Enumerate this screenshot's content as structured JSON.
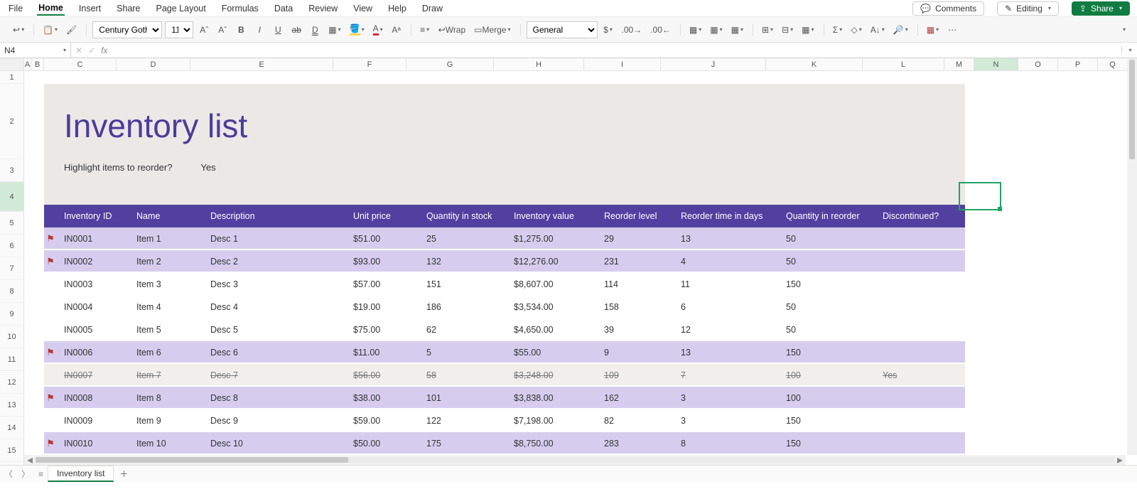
{
  "menu": {
    "tabs": [
      "File",
      "Home",
      "Insert",
      "Share",
      "Page Layout",
      "Formulas",
      "Data",
      "Review",
      "View",
      "Help",
      "Draw"
    ],
    "active": "Home",
    "right": {
      "comments": "Comments",
      "editing": "Editing",
      "share": "Share"
    }
  },
  "ribbon": {
    "font_family": "Century Gothi...",
    "font_size": "11",
    "wrap": "Wrap",
    "merge": "Merge",
    "number_format": "General"
  },
  "formula_bar": {
    "name_box": "N4",
    "formula": ""
  },
  "columns": [
    "A",
    "B",
    "C",
    "D",
    "E",
    "F",
    "G",
    "H",
    "I",
    "J",
    "K",
    "L",
    "M",
    "N",
    "O",
    "P",
    "Q"
  ],
  "selected_column": "N",
  "row_headers": [
    1,
    2,
    3,
    4,
    5,
    6,
    7,
    8,
    9,
    10,
    11,
    12,
    13,
    14,
    15
  ],
  "selected_row": 4,
  "inventory": {
    "title": "Inventory list",
    "subtitle_label": "Highlight items to reorder?",
    "subtitle_value": "Yes",
    "headers": {
      "flag": "",
      "id": "Inventory ID",
      "name": "Name",
      "desc": "Description",
      "price": "Unit price",
      "qty": "Quantity in stock",
      "val": "Inventory value",
      "rl": "Reorder level",
      "rt": "Reorder time in days",
      "qr": "Quantity in reorder",
      "disc": "Discontinued?"
    },
    "rows": [
      {
        "flag": true,
        "id": "IN0001",
        "name": "Item 1",
        "desc": "Desc 1",
        "price": "$51.00",
        "qty": "25",
        "val": "$1,275.00",
        "rl": "29",
        "rt": "13",
        "qr": "50",
        "disc": "",
        "style": "hl"
      },
      {
        "flag": true,
        "id": "IN0002",
        "name": "Item 2",
        "desc": "Desc 2",
        "price": "$93.00",
        "qty": "132",
        "val": "$12,276.00",
        "rl": "231",
        "rt": "4",
        "qr": "50",
        "disc": "",
        "style": "hl"
      },
      {
        "flag": false,
        "id": "IN0003",
        "name": "Item 3",
        "desc": "Desc 3",
        "price": "$57.00",
        "qty": "151",
        "val": "$8,607.00",
        "rl": "114",
        "rt": "11",
        "qr": "150",
        "disc": "",
        "style": "norm"
      },
      {
        "flag": false,
        "id": "IN0004",
        "name": "Item 4",
        "desc": "Desc 4",
        "price": "$19.00",
        "qty": "186",
        "val": "$3,534.00",
        "rl": "158",
        "rt": "6",
        "qr": "50",
        "disc": "",
        "style": "norm"
      },
      {
        "flag": false,
        "id": "IN0005",
        "name": "Item 5",
        "desc": "Desc 5",
        "price": "$75.00",
        "qty": "62",
        "val": "$4,650.00",
        "rl": "39",
        "rt": "12",
        "qr": "50",
        "disc": "",
        "style": "norm"
      },
      {
        "flag": true,
        "id": "IN0006",
        "name": "Item 6",
        "desc": "Desc 6",
        "price": "$11.00",
        "qty": "5",
        "val": "$55.00",
        "rl": "9",
        "rt": "13",
        "qr": "150",
        "disc": "",
        "style": "hl"
      },
      {
        "flag": false,
        "id": "IN0007",
        "name": "Item 7",
        "desc": "Desc 7",
        "price": "$56.00",
        "qty": "58",
        "val": "$3,248.00",
        "rl": "109",
        "rt": "7",
        "qr": "100",
        "disc": "Yes",
        "style": "disc"
      },
      {
        "flag": true,
        "id": "IN0008",
        "name": "Item 8",
        "desc": "Desc 8",
        "price": "$38.00",
        "qty": "101",
        "val": "$3,838.00",
        "rl": "162",
        "rt": "3",
        "qr": "100",
        "disc": "",
        "style": "hl"
      },
      {
        "flag": false,
        "id": "IN0009",
        "name": "Item 9",
        "desc": "Desc 9",
        "price": "$59.00",
        "qty": "122",
        "val": "$7,198.00",
        "rl": "82",
        "rt": "3",
        "qr": "150",
        "disc": "",
        "style": "norm"
      },
      {
        "flag": true,
        "id": "IN0010",
        "name": "Item 10",
        "desc": "Desc 10",
        "price": "$50.00",
        "qty": "175",
        "val": "$8,750.00",
        "rl": "283",
        "rt": "8",
        "qr": "150",
        "disc": "",
        "style": "hl"
      }
    ]
  },
  "sheet_tab": "Inventory list"
}
